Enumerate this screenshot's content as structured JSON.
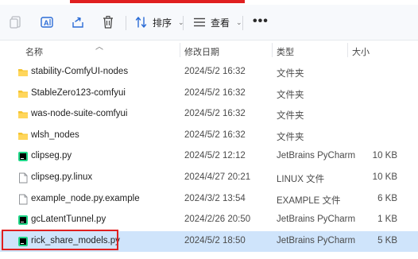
{
  "toolbar": {
    "sort_label": "排序",
    "view_label": "查看",
    "more_label": "•••",
    "icons": [
      "copy-icon",
      "rename-icon",
      "share-icon",
      "delete-icon",
      "sort-icon",
      "view-icon",
      "more-icon"
    ]
  },
  "columns": {
    "name": "名称",
    "modified": "修改日期",
    "type": "类型",
    "size": "大小"
  },
  "files": [
    {
      "icon": "folder-icon",
      "name": "stability-ComfyUI-nodes",
      "modified": "2024/5/2 16:32",
      "type": "文件夹",
      "size": ""
    },
    {
      "icon": "folder-icon",
      "name": "StableZero123-comfyui",
      "modified": "2024/5/2 16:32",
      "type": "文件夹",
      "size": ""
    },
    {
      "icon": "folder-icon",
      "name": "was-node-suite-comfyui",
      "modified": "2024/5/2 16:32",
      "type": "文件夹",
      "size": ""
    },
    {
      "icon": "folder-icon",
      "name": "wlsh_nodes",
      "modified": "2024/5/2 16:32",
      "type": "文件夹",
      "size": ""
    },
    {
      "icon": "pycharm-file-icon",
      "name": "clipseg.py",
      "modified": "2024/5/2 12:12",
      "type": "JetBrains PyCharm",
      "size": "10 KB"
    },
    {
      "icon": "blank-file-icon",
      "name": "clipseg.py.linux",
      "modified": "2024/4/27 20:21",
      "type": "LINUX 文件",
      "size": "10 KB"
    },
    {
      "icon": "blank-file-icon",
      "name": "example_node.py.example",
      "modified": "2024/3/2 13:54",
      "type": "EXAMPLE 文件",
      "size": "6 KB"
    },
    {
      "icon": "pycharm-file-icon",
      "name": "gcLatentTunnel.py",
      "modified": "2024/2/26 20:50",
      "type": "JetBrains PyCharm",
      "size": "1 KB"
    },
    {
      "icon": "pycharm-file-icon",
      "name": "rick_share_models.py",
      "modified": "2024/5/2 18:50",
      "type": "JetBrains PyCharm",
      "size": "5 KB",
      "selected": true
    }
  ],
  "colors": {
    "selection_bg": "#cfe4fb",
    "highlight_red": "#e02020",
    "folder_yellow": "#f4c431"
  }
}
